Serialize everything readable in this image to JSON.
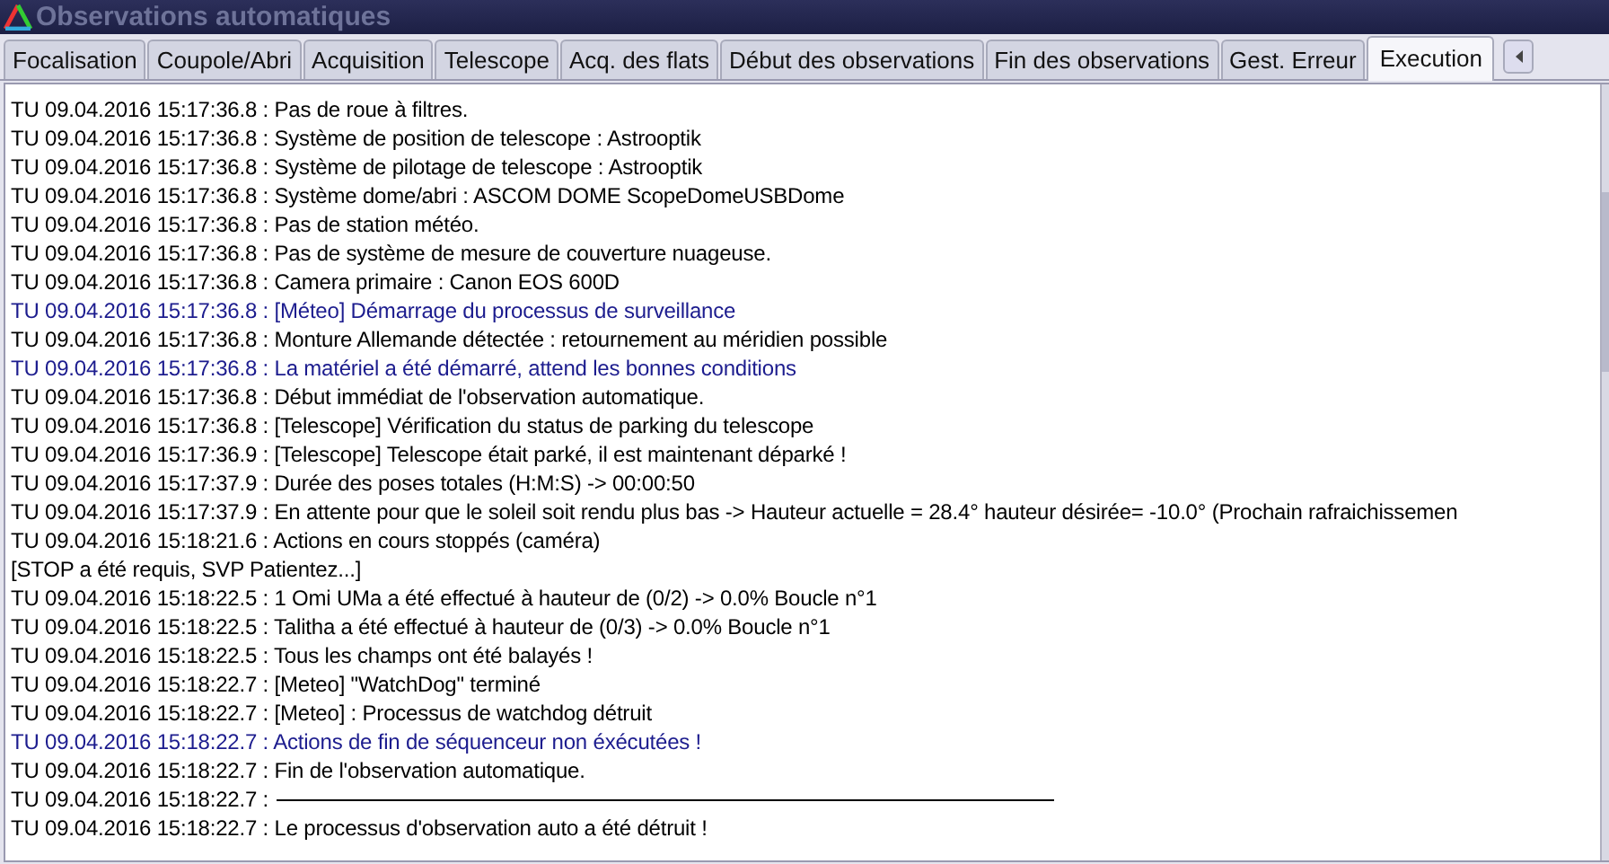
{
  "window": {
    "title": "Observations automatiques"
  },
  "tabs": [
    {
      "label": "Focalisation",
      "selected": false
    },
    {
      "label": "Coupole/Abri",
      "selected": false
    },
    {
      "label": "Acquisition",
      "selected": false
    },
    {
      "label": "Telescope",
      "selected": false
    },
    {
      "label": "Acq. des flats",
      "selected": false
    },
    {
      "label": "Début des observations",
      "selected": false
    },
    {
      "label": "Fin des observations",
      "selected": false
    },
    {
      "label": "Gest. Erreur",
      "selected": false
    },
    {
      "label": "Execution",
      "selected": true
    }
  ],
  "log": [
    {
      "kind": "normal",
      "text": "TU 09.04.2016 15:17:36.8 : Pas de roue à filtres."
    },
    {
      "kind": "normal",
      "text": "TU 09.04.2016 15:17:36.8 : Système de position de telescope : Astrooptik"
    },
    {
      "kind": "normal",
      "text": "TU 09.04.2016 15:17:36.8 : Système de pilotage de telescope : Astrooptik"
    },
    {
      "kind": "normal",
      "text": "TU 09.04.2016 15:17:36.8 : Système dome/abri : ASCOM DOME ScopeDomeUSBDome"
    },
    {
      "kind": "normal",
      "text": "TU 09.04.2016 15:17:36.8 : Pas de station météo."
    },
    {
      "kind": "normal",
      "text": "TU 09.04.2016 15:17:36.8 : Pas de système de mesure de couverture nuageuse."
    },
    {
      "kind": "normal",
      "text": "TU 09.04.2016 15:17:36.8 : Camera primaire : Canon EOS 600D"
    },
    {
      "kind": "info",
      "text": "TU 09.04.2016 15:17:36.8 : [Méteo] Démarrage du processus de surveillance"
    },
    {
      "kind": "normal",
      "text": "TU 09.04.2016 15:17:36.8 : Monture Allemande détectée : retournement au méridien possible"
    },
    {
      "kind": "info",
      "text": "TU 09.04.2016 15:17:36.8 : La matériel a été démarré, attend les bonnes conditions"
    },
    {
      "kind": "normal",
      "text": "TU 09.04.2016 15:17:36.8 : Début immédiat de l'observation automatique."
    },
    {
      "kind": "normal",
      "text": "TU 09.04.2016 15:17:36.8 : [Telescope] Vérification du status de parking du telescope"
    },
    {
      "kind": "normal",
      "text": "TU 09.04.2016 15:17:36.9 : [Telescope] Telescope était parké, il est maintenant déparké !"
    },
    {
      "kind": "normal",
      "text": "TU 09.04.2016 15:17:37.9 : Durée des poses totales (H:M:S) -> 00:00:50"
    },
    {
      "kind": "normal",
      "text": "TU 09.04.2016 15:17:37.9 : En attente pour que le soleil soit rendu plus bas -> Hauteur actuelle = 28.4° hauteur désirée= -10.0° (Prochain rafraichissemen"
    },
    {
      "kind": "normal",
      "text": "TU 09.04.2016 15:18:21.6 : Actions en cours stoppés (caméra)"
    },
    {
      "kind": "normal",
      "text": "[STOP a été requis, SVP Patientez...]"
    },
    {
      "kind": "normal",
      "text": "TU 09.04.2016 15:18:22.5 :   1 Omi UMa a été effectué à hauteur de  (0/2) -> 0.0%  Boucle n°1"
    },
    {
      "kind": "normal",
      "text": "TU 09.04.2016 15:18:22.5 :   Talitha a été effectué à hauteur de  (0/3) -> 0.0%  Boucle n°1"
    },
    {
      "kind": "normal",
      "text": "TU 09.04.2016 15:18:22.5 : Tous les champs ont été balayés !"
    },
    {
      "kind": "normal",
      "text": "TU 09.04.2016 15:18:22.7 : [Meteo] \"WatchDog\" terminé"
    },
    {
      "kind": "normal",
      "text": "TU 09.04.2016 15:18:22.7 : [Meteo] : Processus de watchdog détruit"
    },
    {
      "kind": "info",
      "text": "TU 09.04.2016 15:18:22.7 : Actions de fin de séquenceur non éxécutées !"
    },
    {
      "kind": "normal",
      "text": "TU 09.04.2016 15:18:22.7 : Fin de l'observation automatique."
    },
    {
      "kind": "rule",
      "text": "TU 09.04.2016 15:18:22.7 :"
    },
    {
      "kind": "normal",
      "text": "TU 09.04.2016 15:18:22.7 : Le processus d'observation auto a été détruit !"
    }
  ]
}
